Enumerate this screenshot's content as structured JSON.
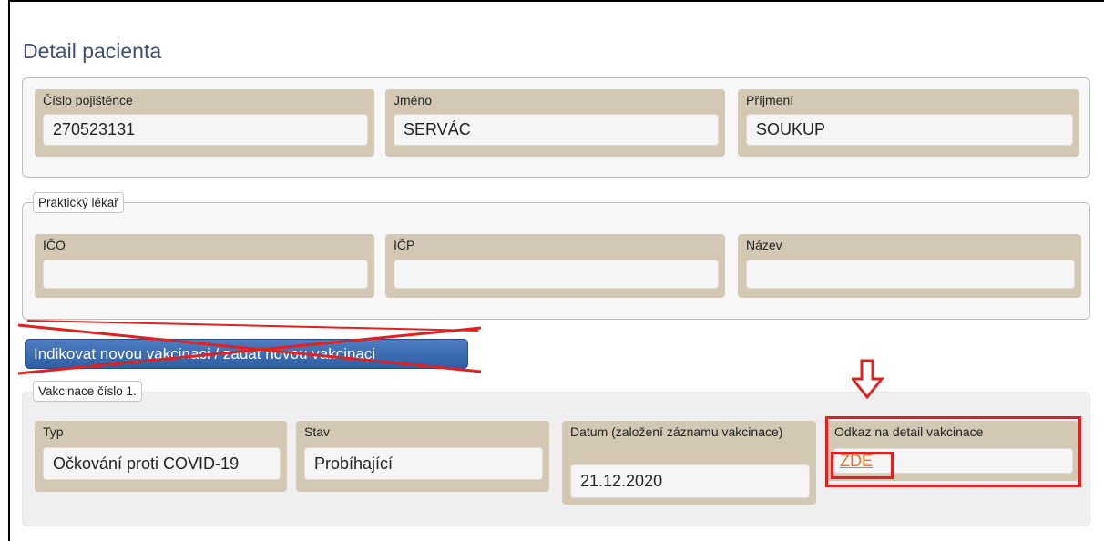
{
  "page": {
    "title": "Detail pacienta"
  },
  "patient": {
    "insurance_label": "Číslo pojištěnce",
    "insurance_value": "270523131",
    "first_name_label": "Jméno",
    "first_name_value": "SERVÁC",
    "last_name_label": "Příjmení",
    "last_name_value": "SOUKUP"
  },
  "doctor": {
    "legend": "Praktický lékař",
    "ico_label": "IČO",
    "ico_value": "",
    "icp_label": "IČP",
    "icp_value": "",
    "name_label": "Název",
    "name_value": ""
  },
  "action": {
    "new_vaccination_label": "Indikovat novou vakcinaci / zadat novou vakcinaci"
  },
  "vaccination": {
    "legend": "Vakcinace číslo 1.",
    "type_label": "Typ",
    "type_value": "Očkování proti COVID-19",
    "status_label": "Stav",
    "status_value": "Probíhající",
    "date_label": "Datum (založení záznamu vakcinace)",
    "date_value": "21.12.2020",
    "detail_label": "Odkaz na detail vakcinace",
    "detail_link": "ZDE"
  },
  "colors": {
    "highlight": "#e1211f",
    "link": "#e8741c",
    "button": "#3a67ad"
  }
}
